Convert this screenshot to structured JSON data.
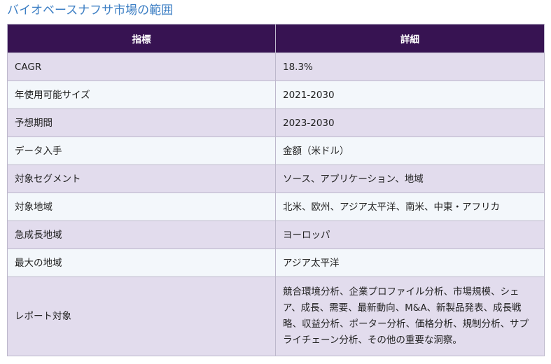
{
  "title": "バイオベースナフサ市場の範囲",
  "table": {
    "headers": [
      "指標",
      "詳細"
    ],
    "rows": [
      {
        "metric": "CAGR",
        "detail": "18.3%"
      },
      {
        "metric": "年使用可能サイズ",
        "detail": "2021-2030"
      },
      {
        "metric": "予想期間",
        "detail": "2023-2030"
      },
      {
        "metric": "データ入手",
        "detail": "金額（米ドル）"
      },
      {
        "metric": "対象セグメント",
        "detail": "ソース、アプリケーション、地域"
      },
      {
        "metric": "対象地域",
        "detail": "北米、欧州、アジア太平洋、南米、中東・アフリカ"
      },
      {
        "metric": "急成長地域",
        "detail": "ヨーロッパ"
      },
      {
        "metric": "最大の地域",
        "detail": "アジア太平洋"
      },
      {
        "metric": "レポート対象",
        "detail": "競合環境分析、企業プロファイル分析、市場規模、シェア、成長、需要、最新動向、M&A、新製品発表、成長戦略、収益分析、ポーター分析、価格分析、規制分析、サプライチェーン分析、その他の重要な洞察。"
      }
    ]
  },
  "colors": {
    "title": "#3d7fc4",
    "header_bg": "#371352",
    "row_odd_bg": "#e2dced",
    "row_even_bg": "#f3f7fb",
    "border": "#bdb8cc"
  }
}
